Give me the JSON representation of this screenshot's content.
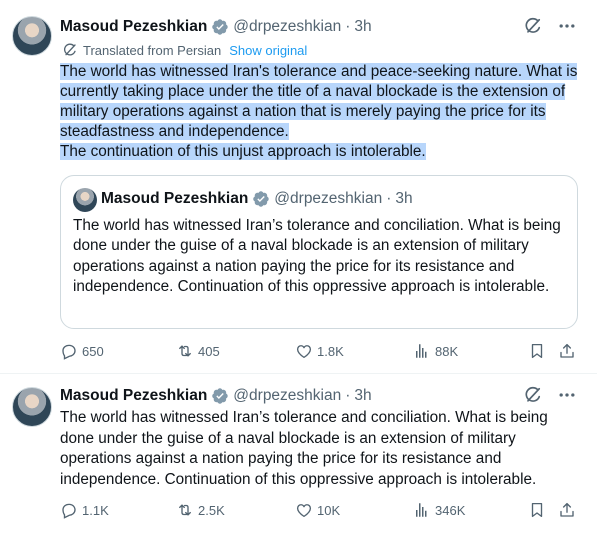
{
  "tweets": [
    {
      "author_name": "Masoud Pezeshkian",
      "handle": "@drpezeshkian",
      "separator": "·",
      "time": "3h",
      "translated_label": "Translated from Persian",
      "show_original": "Show original",
      "body_lines": [
        "The world has witnessed Iran's tolerance and peace-seeking nature. What is currently taking place under the title of a naval blockade is the extension of military operations against a nation that is merely paying the price for its steadfastness and independence.",
        "The continuation of this unjust approach is intolerable."
      ],
      "quote": {
        "author_name": "Masoud Pezeshkian",
        "handle": "@drpezeshkian",
        "separator": "·",
        "time": "3h",
        "body": "The world has witnessed Iran’s tolerance and conciliation. What is being done under the guise of a naval blockade is an extension of military operations against a nation paying the price for its resistance and independence. Continuation of this oppressive approach is intolerable."
      },
      "stats": {
        "replies": "650",
        "reposts": "405",
        "likes": "1.8K",
        "views": "88K"
      }
    },
    {
      "author_name": "Masoud Pezeshkian",
      "handle": "@drpezeshkian",
      "separator": "·",
      "time": "3h",
      "body": "The world has witnessed Iran’s tolerance and conciliation. What is being done under the guise of a naval blockade is an extension of military operations against a nation paying the price for its resistance and independence. Continuation of this oppressive approach is intolerable.",
      "stats": {
        "replies": "1.1K",
        "reposts": "2.5K",
        "likes": "10K",
        "views": "346K"
      }
    }
  ],
  "colors": {
    "text": "#0f1419",
    "muted": "#536471",
    "link": "#1d9bf0",
    "highlight": "#b8d6fb",
    "verified": "#829aab",
    "border": "#cfd9de"
  }
}
